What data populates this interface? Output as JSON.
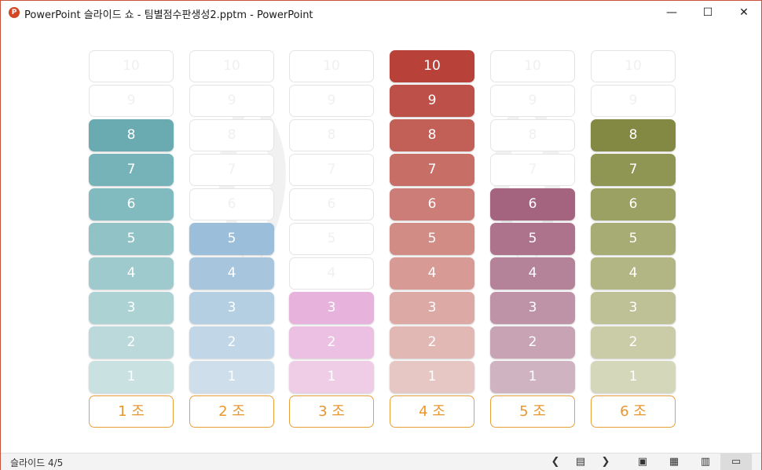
{
  "window": {
    "title": "PowerPoint 슬라이드 쇼  -  팀별점수판생성2.pptm - PowerPoint",
    "app_icon": "P",
    "minimize_icon": "—",
    "maximize_icon": "☐",
    "close_icon": "✕"
  },
  "scoreboard": {
    "levels": [
      "10",
      "9",
      "8",
      "7",
      "6",
      "5",
      "4",
      "3",
      "2",
      "1"
    ],
    "teams": [
      {
        "label": "1 조",
        "score": 8,
        "colors": [
          "#69abb1",
          "#75b3b8",
          "#82bbbf",
          "#90c2c6",
          "#9ecacd",
          "#add2d4",
          "#bbd9db",
          "#cae1e2"
        ]
      },
      {
        "label": "2 조",
        "score": 5,
        "colors": [
          "#9bbfda",
          "#a7c6de",
          "#b4cee2",
          "#c1d6e7",
          "#cedfeb"
        ]
      },
      {
        "label": "3 조",
        "score": 3,
        "colors": [
          "#e7b3dc",
          "#ebc0e2",
          "#efcde7"
        ]
      },
      {
        "label": "4 조",
        "score": 10,
        "colors": [
          "#b8413a",
          "#bd5048",
          "#c25f57",
          "#c76e67",
          "#cd7d77",
          "#d28c86",
          "#d79a95",
          "#dca9a5",
          "#e1b8b4",
          "#e6c7c4"
        ]
      },
      {
        "label": "5 조",
        "score": 6,
        "colors": [
          "#a4647f",
          "#ad738c",
          "#b58399",
          "#be93a7",
          "#c7a3b4",
          "#d0b3c1"
        ]
      },
      {
        "label": "6 조",
        "score": 8,
        "colors": [
          "#838943",
          "#8f9553",
          "#9ba063",
          "#a7ab74",
          "#b2b685",
          "#bec196",
          "#c9cca7",
          "#d4d7b9"
        ]
      }
    ]
  },
  "statusbar": {
    "slide_indicator": "슬라이드 4/5",
    "prev_icon": "❮",
    "slides_icon": "▤",
    "next_icon": "❯",
    "normal_view_icon": "▣",
    "sorter_view_icon": "▦",
    "reading_view_icon": "▥",
    "slideshow_view_icon": "▭"
  }
}
